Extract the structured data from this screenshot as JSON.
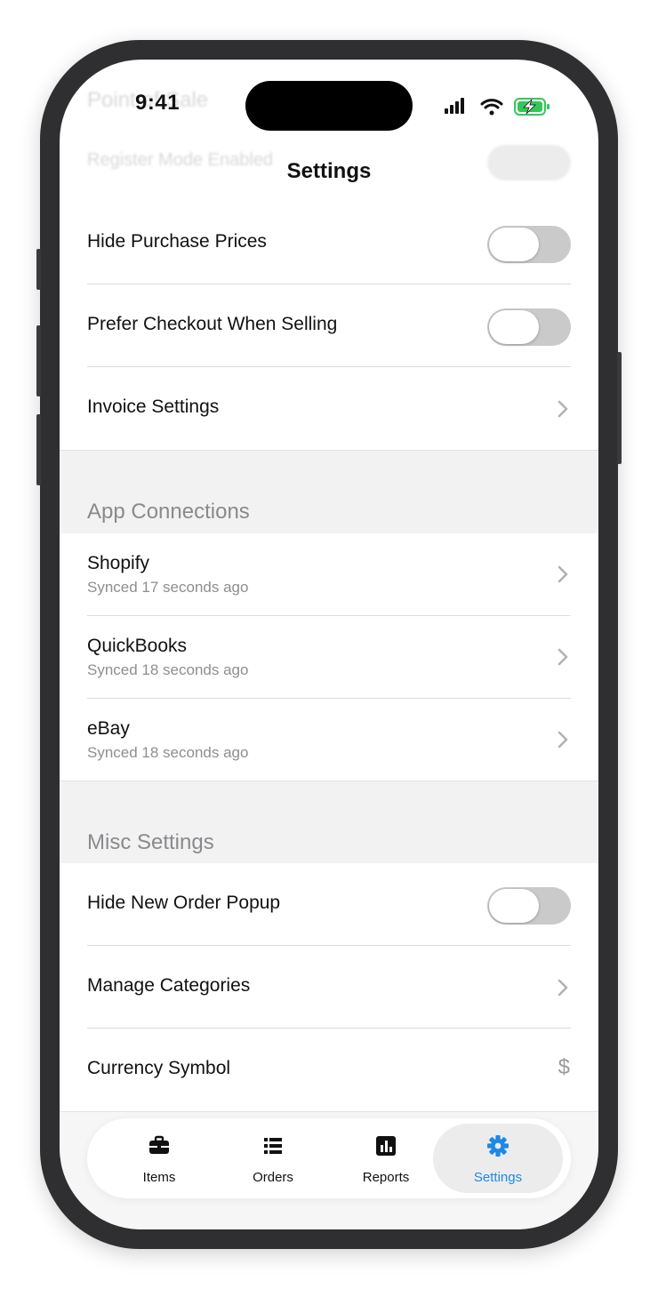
{
  "status_bar": {
    "time": "9:41",
    "icons": [
      "cellular-signal-icon",
      "wifi-icon",
      "battery-charging-icon"
    ]
  },
  "faded_content": {
    "section_header": "Point of Sale",
    "row_label": "Register Mode Enabled"
  },
  "nav": {
    "title": "Settings"
  },
  "pos_rows": [
    {
      "label": "Hide Purchase Prices",
      "control": "toggle",
      "on": false
    },
    {
      "label": "Prefer Checkout When Selling",
      "control": "toggle",
      "on": false
    },
    {
      "label": "Invoice Settings",
      "control": "chevron"
    }
  ],
  "app_connections": {
    "header": "App Connections",
    "rows": [
      {
        "label": "Shopify",
        "sub": "Synced 17 seconds ago"
      },
      {
        "label": "QuickBooks",
        "sub": "Synced 18 seconds ago"
      },
      {
        "label": "eBay",
        "sub": "Synced 18 seconds ago"
      }
    ]
  },
  "misc": {
    "header": "Misc Settings",
    "rows": [
      {
        "label": "Hide New Order Popup",
        "control": "toggle",
        "on": false
      },
      {
        "label": "Manage Categories",
        "control": "chevron"
      },
      {
        "label": "Currency Symbol",
        "value": "$"
      }
    ]
  },
  "tabs": [
    {
      "label": "Items",
      "icon": "briefcase-icon",
      "active": false
    },
    {
      "label": "Orders",
      "icon": "list-icon",
      "active": false
    },
    {
      "label": "Reports",
      "icon": "bar-chart-icon",
      "active": false
    },
    {
      "label": "Settings",
      "icon": "gear-icon",
      "active": true
    }
  ],
  "colors": {
    "accent": "#1e88e5",
    "toggle_off": "#cacaca",
    "section_bg": "#f2f2f2",
    "secondary_text": "#8e8e93",
    "battery_green": "#34c759"
  }
}
